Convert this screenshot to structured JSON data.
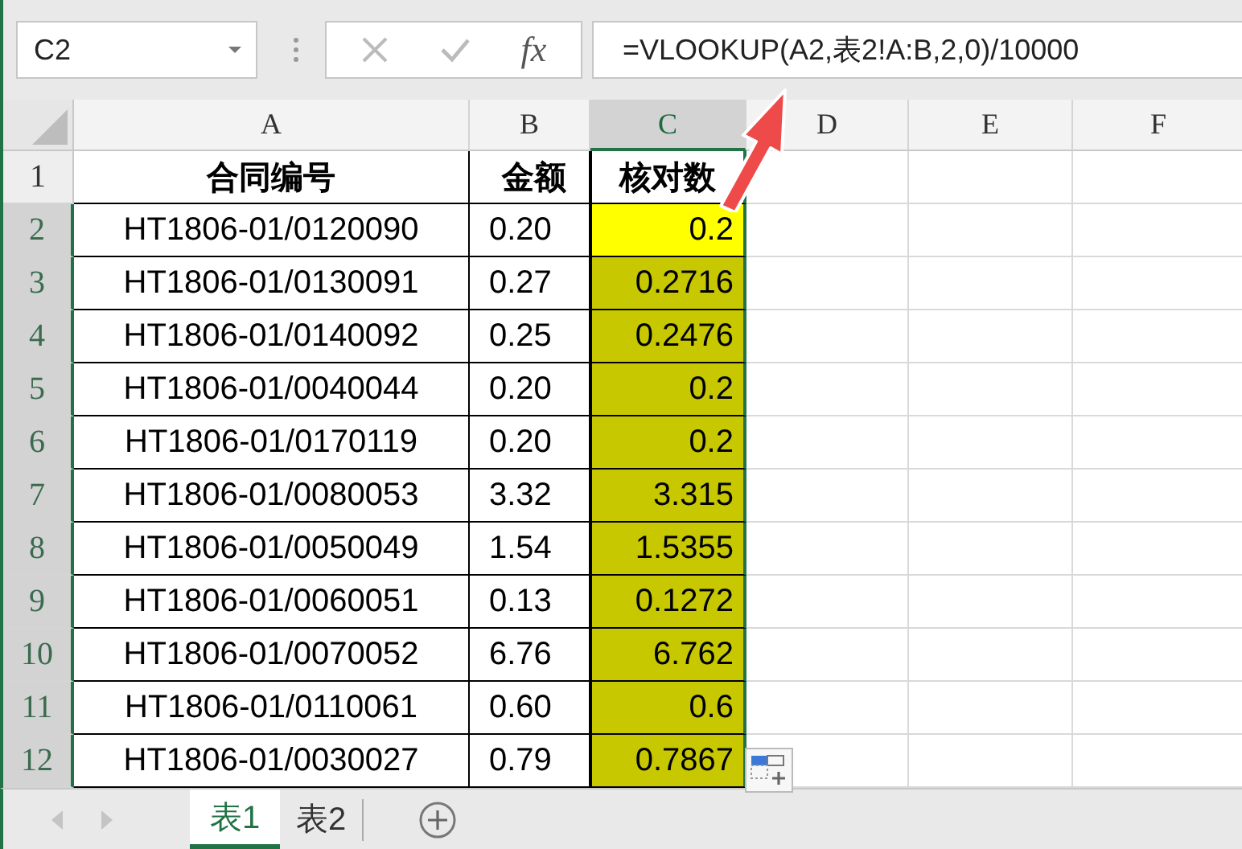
{
  "name_box": {
    "value": "C2"
  },
  "formula_bar": {
    "fx": "fx",
    "formula": "=VLOOKUP(A2,表2!A:B,2,0)/10000"
  },
  "columns": [
    {
      "label": "A",
      "selected": false
    },
    {
      "label": "B",
      "selected": false
    },
    {
      "label": "C",
      "selected": true
    },
    {
      "label": "D",
      "selected": false
    },
    {
      "label": "E",
      "selected": false
    },
    {
      "label": "F",
      "selected": false
    }
  ],
  "header_row": {
    "number": "1",
    "selected": false,
    "cells": [
      "合同编号",
      "金额",
      "核对数"
    ]
  },
  "rows": [
    {
      "number": "2",
      "selected": true,
      "cells": [
        "HT1806-01/0120090",
        "0.20",
        "0.2"
      ],
      "color": "#ffff00"
    },
    {
      "number": "3",
      "selected": true,
      "cells": [
        "HT1806-01/0130091",
        "0.27",
        "0.2716"
      ],
      "color": "#c8c800"
    },
    {
      "number": "4",
      "selected": true,
      "cells": [
        "HT1806-01/0140092",
        "0.25",
        "0.2476"
      ],
      "color": "#c8c800"
    },
    {
      "number": "5",
      "selected": true,
      "cells": [
        "HT1806-01/0040044",
        "0.20",
        "0.2"
      ],
      "color": "#c8c800"
    },
    {
      "number": "6",
      "selected": true,
      "cells": [
        "HT1806-01/0170119",
        "0.20",
        "0.2"
      ],
      "color": "#c8c800"
    },
    {
      "number": "7",
      "selected": true,
      "cells": [
        "HT1806-01/0080053",
        "3.32",
        "3.315"
      ],
      "color": "#c8c800"
    },
    {
      "number": "8",
      "selected": true,
      "cells": [
        "HT1806-01/0050049",
        "1.54",
        "1.5355"
      ],
      "color": "#c8c800"
    },
    {
      "number": "9",
      "selected": true,
      "cells": [
        "HT1806-01/0060051",
        "0.13",
        "0.1272"
      ],
      "color": "#c8c800"
    },
    {
      "number": "10",
      "selected": true,
      "cells": [
        "HT1806-01/0070052",
        "6.76",
        "6.762"
      ],
      "color": "#c8c800"
    },
    {
      "number": "11",
      "selected": true,
      "cells": [
        "HT1806-01/0110061",
        "0.60",
        "0.6"
      ],
      "color": "#c8c800"
    },
    {
      "number": "12",
      "selected": true,
      "cells": [
        "HT1806-01/0030027",
        "0.79",
        "0.7867"
      ],
      "color": "#c8c800"
    }
  ],
  "sheet_tabs": [
    {
      "label": "表1",
      "selected": true
    },
    {
      "label": "表2",
      "selected": false
    }
  ]
}
